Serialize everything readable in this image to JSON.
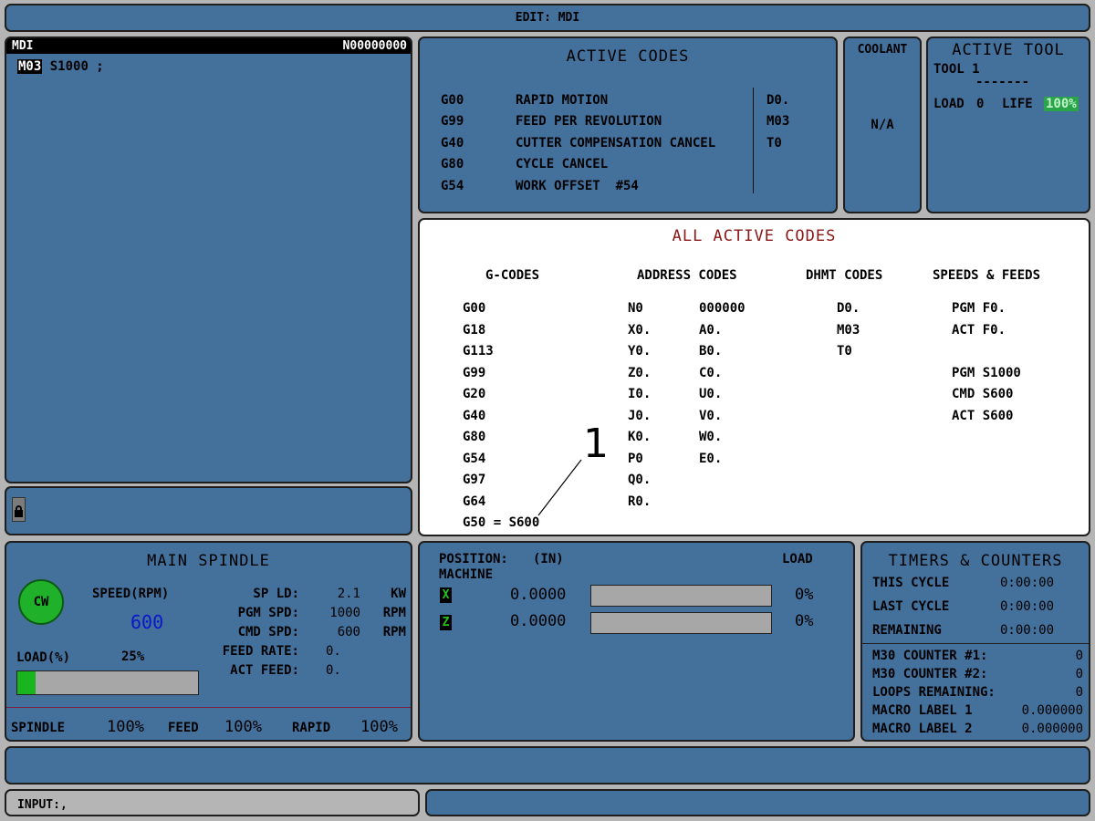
{
  "top_bar": {
    "title": "EDIT: MDI"
  },
  "mdi": {
    "header_left": "MDI",
    "header_right": "N00000000",
    "cursor_word": "M03",
    "program_rest": " S1000 ;"
  },
  "lock": {
    "icon": "lock-icon"
  },
  "active_codes": {
    "title": "ACTIVE CODES",
    "rows": [
      {
        "code": "G00",
        "desc": "RAPID MOTION"
      },
      {
        "code": "G99",
        "desc": "FEED PER REVOLUTION"
      },
      {
        "code": "G40",
        "desc": "CUTTER COMPENSATION CANCEL"
      },
      {
        "code": "G80",
        "desc": "CYCLE CANCEL"
      },
      {
        "code": "G54",
        "desc": "WORK OFFSET  #54"
      }
    ],
    "right": [
      "D0.",
      "M03",
      "T0"
    ]
  },
  "coolant": {
    "title": "COOLANT",
    "value": "N/A"
  },
  "active_tool": {
    "title": "ACTIVE TOOL",
    "tool": "TOOL 1",
    "dashes": "-------",
    "load_label": "LOAD",
    "load_value": "0",
    "life_label": "LIFE",
    "life_value": "100%"
  },
  "all_active_codes": {
    "title": "ALL ACTIVE CODES",
    "headers": {
      "g": "G-CODES",
      "addr": "ADDRESS CODES",
      "dhmt": "DHMT CODES",
      "sf": "SPEEDS & FEEDS"
    },
    "g_codes": [
      "G00",
      "G18",
      "G113",
      "G99",
      "G20",
      "G40",
      "G80",
      "G54",
      "G97",
      "G64",
      "G50 = S600"
    ],
    "address_col1": [
      "N0",
      "X0.",
      "Y0.",
      "Z0.",
      "I0.",
      "J0.",
      "K0.",
      "P0",
      "Q0.",
      "R0."
    ],
    "address_col2": [
      "000000",
      "A0.",
      "B0.",
      "C0.",
      "U0.",
      "V0.",
      "W0.",
      "E0."
    ],
    "dhmt": [
      "D0.",
      "M03",
      "T0"
    ],
    "speeds_feeds": [
      "PGM F0.",
      "ACT F0.",
      "",
      "PGM S1000",
      "CMD S600",
      "ACT S600"
    ]
  },
  "callout": {
    "label": "1"
  },
  "main_spindle": {
    "title": "MAIN SPINDLE",
    "direction": "CW",
    "speed_label": "SPEED(RPM)",
    "speed_value": "600",
    "sp_ld_label": "SP LD:",
    "sp_ld_value": "2.1",
    "sp_ld_unit": "KW",
    "pgm_spd_label": "PGM SPD:",
    "pgm_spd_value": "1000",
    "pgm_spd_unit": "RPM",
    "cmd_spd_label": "CMD SPD:",
    "cmd_spd_value": "600",
    "cmd_spd_unit": "RPM",
    "feed_rate_label": "FEED RATE:",
    "feed_rate_value": "0.",
    "act_feed_label": "ACT FEED:",
    "act_feed_value": "0.",
    "load_label": "LOAD(%)",
    "load_text": "25%",
    "load_percent": 0.1,
    "spindle_label": "SPINDLE",
    "spindle_override": "100%",
    "feed_label": "FEED",
    "feed_override": "100%",
    "rapid_label": "RAPID",
    "rapid_override": "100%"
  },
  "position": {
    "title": "POSITION:",
    "units": "(IN)",
    "mode": "MACHINE",
    "load_header": "LOAD",
    "axes": [
      {
        "name": "X",
        "value": "0.0000",
        "load": "0%",
        "load_fraction": 0
      },
      {
        "name": "Z",
        "value": "0.0000",
        "load": "0%",
        "load_fraction": 0
      }
    ]
  },
  "timers": {
    "title": "TIMERS & COUNTERS",
    "this_cycle_label": "THIS CYCLE",
    "this_cycle": "0:00:00",
    "last_cycle_label": "LAST CYCLE",
    "last_cycle": "0:00:00",
    "remaining_label": "REMAINING",
    "remaining": "0:00:00",
    "m30_1_label": "M30 COUNTER #1:",
    "m30_1": "0",
    "m30_2_label": "M30 COUNTER #2:",
    "m30_2": "0",
    "loops_label": "LOOPS REMAINING:",
    "loops": "0",
    "macro1_label": "MACRO LABEL 1",
    "macro1": "0.000000",
    "macro2_label": "MACRO LABEL 2",
    "macro2": "0.000000"
  },
  "input_bar": {
    "label": "INPUT:",
    "value": ","
  },
  "colors": {
    "panel": "#44709c",
    "background": "#b5b5b5",
    "accent_green": "#1fb12a",
    "title_red": "#8b1616",
    "speed_blue": "#0a17c8"
  }
}
